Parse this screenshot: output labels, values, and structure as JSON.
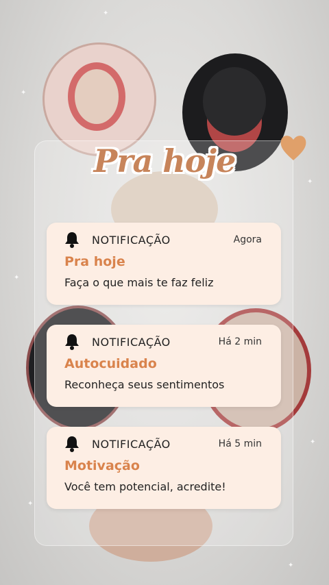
{
  "title": "Pra hoje",
  "colors": {
    "card_background": "#fdeee4",
    "accent_orange": "#d9834c",
    "title_color": "#c7845a",
    "heart": "#e0a06a"
  },
  "icons": {
    "notification": "bell-icon",
    "decoration": "heart-icon"
  },
  "notifications": [
    {
      "header": "NOTIFICAÇÃO",
      "time": "Agora",
      "title": "Pra hoje",
      "message": "Faça o que mais te faz feliz"
    },
    {
      "header": "NOTIFICAÇÃO",
      "time": "Há 2 min",
      "title": "Autocuidado",
      "message": "Reconheça seus sentimentos"
    },
    {
      "header": "NOTIFICAÇÃO",
      "time": "Há 5 min",
      "title": "Motivação",
      "message": "Você tem potencial, acredite!"
    }
  ]
}
